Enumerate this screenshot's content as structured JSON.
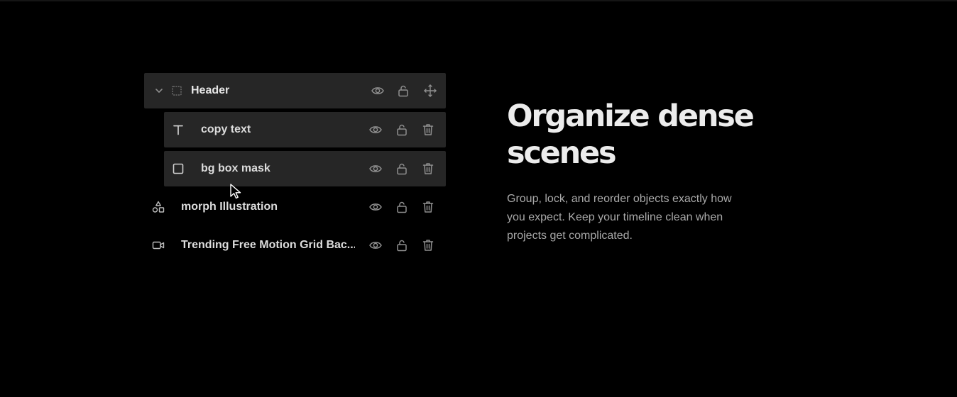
{
  "layers_panel": {
    "group": {
      "label": "Header",
      "icons": [
        "chevron-down-icon",
        "frame-icon",
        "eye-icon",
        "unlock-icon",
        "move-icon"
      ]
    },
    "children": [
      {
        "label": "copy text",
        "type_icon": "text-icon"
      },
      {
        "label": "bg box mask",
        "type_icon": "square-icon"
      }
    ],
    "root_items": [
      {
        "label": "morph Illustration",
        "type_icon": "shapes-icon"
      },
      {
        "label": "Trending Free Motion Grid Bac...",
        "type_icon": "video-icon"
      }
    ]
  },
  "feature": {
    "headline": "Organize dense scenes",
    "body": "Group, lock, and reorder objects exactly how you expect. Keep your timeline clean when projects get complicated."
  },
  "colors": {
    "background": "#000000",
    "row_background": "#262626",
    "icon_gray": "#8f8f8f",
    "headline": "#ececec",
    "body": "#a9a9a9"
  }
}
